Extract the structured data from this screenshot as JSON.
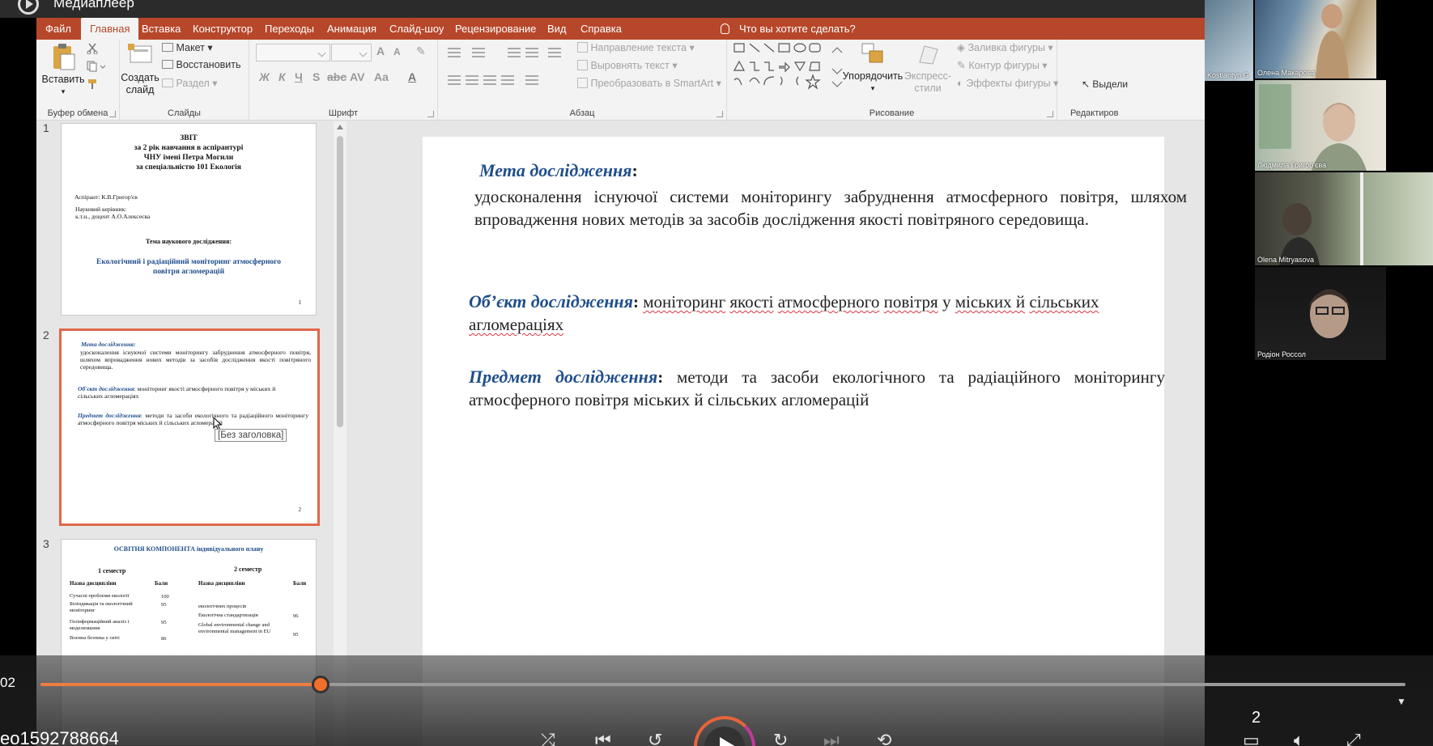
{
  "player": {
    "title": "Медиаплеер"
  },
  "menu": {
    "tabs": [
      "Файл",
      "Главная",
      "Вставка",
      "Конструктор",
      "Переходы",
      "Анимация",
      "Слайд-шоу",
      "Рецензирование",
      "Вид",
      "Справка"
    ],
    "active_tab": "Главная",
    "tell_me": "Что вы хотите сделать?"
  },
  "ribbon": {
    "clipboard": {
      "paste": "Вставить",
      "label": "Буфер обмена"
    },
    "slides": {
      "new_slide": "Создать слайд",
      "layout": "Макет",
      "reset": "Восстановить",
      "section": "Раздел",
      "label": "Слайды"
    },
    "font": {
      "label": "Шрифт"
    },
    "paragraph": {
      "text_direction": "Направление текста",
      "align_text": "Выровнять текст",
      "smartart": "Преобразовать в SmartArt",
      "label": "Абзац"
    },
    "drawing": {
      "arrange": "Упорядочить",
      "quick_styles": "Экспресс-стили",
      "shape_fill": "Заливка фигуры",
      "shape_outline": "Контур фигуры",
      "shape_effects": "Эффекты фигуры",
      "label": "Рисование"
    },
    "editing": {
      "label": "Редактиров",
      "select": "Выдели"
    }
  },
  "thumbnails": {
    "numbers": [
      "1",
      "2",
      "3"
    ],
    "slide1": {
      "title_lines": [
        "ЗВІТ",
        "за 2 рік навчання в аспірантурі",
        "ЧНУ імені Петра Могили",
        "за спеціальністю 101 Екологія"
      ],
      "aspirant": "Аспірант: К.В.Григор'єв",
      "supervisor_label": "Науковий керівник:",
      "supervisor": "к.т.н., доцент А.О.Алексеєва",
      "topic_label": "Тема наукового дослідження:",
      "topic": "Екологічний і радіаційний моніторинг атмосферного повітря агломерацій",
      "page": "1"
    },
    "slide2": {
      "aim_head": "Мета дослідження:",
      "aim_text": "удосконалення існуючої системи моніторингу забруднення атмосферного повітря, шляхом впровадження нових методів за засобів дослідження якості повітряного середовища.",
      "object_head": "Об'єкт дослідження",
      "object_text": ": моніторинг якості атмосферного повітря у міських й сільських агломераціях",
      "subject_head": "Предмет дослідження",
      "subject_text": ": методи та засоби екологічного та радіаційного моніторингу атмосферного повітря міських й сільських агломерацій",
      "page": "2"
    },
    "slide3": {
      "title": "ОСВІТНЯ КОМПОНЕНТА індивідуального плану",
      "sem1": "1 семестр",
      "sem2": "2 семестр",
      "col_name": "Назва дисципліни",
      "col_score": "Бали",
      "rows_left": [
        {
          "name": "Сучасні проблеми екології",
          "score": "100"
        },
        {
          "name": "Біоіндикація та екологічний моніторинг",
          "score": "95"
        },
        {
          "name": "Геоінформаційний аналіз і моделювання",
          "score": "95"
        },
        {
          "name": "Воєнна безпека у світі",
          "score": "86"
        }
      ],
      "rows_right": [
        {
          "name": "екологічних процесів",
          "score": ""
        },
        {
          "name": "Екологічна стандартизація",
          "score": "96"
        },
        {
          "name": "Global environmental change and environmental management in EU",
          "score": "95"
        }
      ]
    },
    "tooltip": "[Без заголовка]"
  },
  "slide": {
    "aim_head": "Мета дослідження",
    "aim_colon": ":",
    "aim_text": "удосконалення існуючої системи моніторингу забруднення атмосферного повітря, шляхом впровадження нових методів за засобів дослідження якості повітряного середовища.",
    "object_head": "Об’єкт дослідження",
    "object_colon": ":",
    "object_text_a": "моніторинг",
    "object_text_b": "якості",
    "object_text_c": "атмосферного",
    "object_text_d": "повітря",
    "object_text_e": "у",
    "object_text_f": "міських й",
    "object_text_g": "сільських агломераціях",
    "subject_head": "Предмет дослідження",
    "subject_colon": ":",
    "subject_text": "методи та засоби екологічного та радіаційного моніторингу атмосферного повітря міських й сільських агломерацій"
  },
  "participants": [
    {
      "name": "Олена Макарова"
    },
    {
      "name": "Kostiantyn G"
    },
    {
      "name": "Людмила Григор'єва"
    },
    {
      "name": "Olena Mitryasova"
    },
    {
      "name": "Родіон Россол"
    }
  ],
  "controls": {
    "time_left": "02",
    "file_name": "ео1592788664",
    "page_count": "2",
    "progress_percent": 20.5
  },
  "colors": {
    "accent": "#b7472a",
    "heading_blue": "#1f4e8c",
    "progress": "#ec7c44",
    "selection": "#e0674a"
  }
}
